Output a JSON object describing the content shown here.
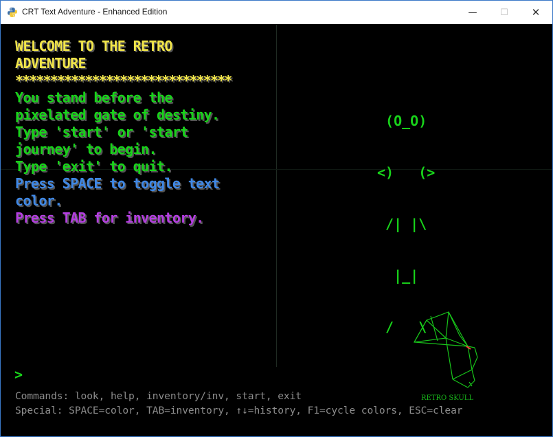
{
  "window": {
    "title": "CRT Text Adventure - Enhanced Edition",
    "icon": "python-icon",
    "controls": {
      "minimize": "—",
      "maximize": "☐",
      "close": "✕"
    }
  },
  "colors": {
    "yellow": "#f2e64a",
    "green": "#18d31a",
    "blue": "#3f88e6",
    "purple": "#b43ee0",
    "help": "#8c8c8c"
  },
  "output": {
    "lines": [
      {
        "text": "WELCOME TO THE RETRO",
        "color": "yellow"
      },
      {
        "text": "ADVENTURE",
        "color": "yellow"
      },
      {
        "text": "*******************************",
        "color": "yellow"
      },
      {
        "text": "You stand before the",
        "color": "green"
      },
      {
        "text": "pixelated gate of destiny.",
        "color": "green"
      },
      {
        "text": "Type 'start' or 'start",
        "color": "green"
      },
      {
        "text": "journey' to begin.",
        "color": "green"
      },
      {
        "text": "Type 'exit' to quit.",
        "color": "green"
      },
      {
        "text": "Press SPACE to toggle text",
        "color": "blue"
      },
      {
        "text": "color.",
        "color": "blue"
      },
      {
        "text": "Press TAB for inventory.",
        "color": "purple"
      }
    ]
  },
  "ascii_figure": {
    "lines": [
      " (O_O)",
      "<)   (>",
      " /| |\\",
      "  |_|",
      " /   \\"
    ]
  },
  "skull": {
    "label": "RETRO SKULL"
  },
  "input": {
    "prompt": ">"
  },
  "help": {
    "commands": "Commands: look, help, inventory/inv, start, exit",
    "special": "Special: SPACE=color, TAB=inventory, ↑↓=history, F1=cycle colors, ESC=clear"
  }
}
